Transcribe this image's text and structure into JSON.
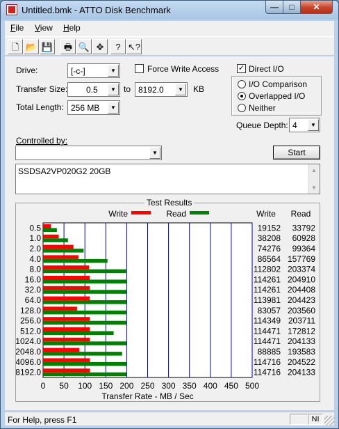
{
  "window": {
    "title": "Untitled.bmk - ATTO Disk Benchmark"
  },
  "window_buttons": {
    "minimize": "—",
    "maximize": "□",
    "close": "✕"
  },
  "menu": [
    {
      "accel": "F",
      "rest": "ile"
    },
    {
      "accel": "V",
      "rest": "iew"
    },
    {
      "accel": "H",
      "rest": "elp"
    }
  ],
  "toolbar_icons": [
    "new-icon",
    "open-icon",
    "save-icon",
    "print-icon",
    "print-preview-icon",
    "move-icon",
    "help-icon",
    "context-help-icon"
  ],
  "drive": {
    "label": "Drive:",
    "value": "[-c-]"
  },
  "transfer_size": {
    "label": "Transfer Size:",
    "from": "0.5",
    "to_label": "to",
    "to": "8192.0",
    "unit": "KB"
  },
  "total_length": {
    "label": "Total Length:",
    "value": "256 MB"
  },
  "force_write_access": {
    "label": "Force Write Access",
    "checked": false
  },
  "direct_io": {
    "label": "Direct I/O",
    "checked": true,
    "mark": "✓"
  },
  "io_mode": {
    "options": [
      {
        "label": "I/O Comparison",
        "selected": false
      },
      {
        "label": "Overlapped I/O",
        "selected": true
      },
      {
        "label": "Neither",
        "selected": false
      }
    ]
  },
  "queue_depth": {
    "label": "Queue Depth:",
    "value": "4"
  },
  "controlled_by": {
    "label": "Controlled by:",
    "value": ""
  },
  "start_button": {
    "label": "Start"
  },
  "description": {
    "text": "SSDSA2VP020G2 20GB"
  },
  "colors": {
    "write": "#ff0000",
    "read": "#008000",
    "grid": "#0000c0"
  },
  "chart_data": {
    "type": "bar",
    "title": "Test Results",
    "orientation": "horizontal",
    "xlabel": "Transfer Rate - MB / Sec",
    "xlim": [
      0,
      500
    ],
    "xticks": [
      0,
      50,
      100,
      150,
      200,
      250,
      300,
      350,
      400,
      450,
      500
    ],
    "legend": [
      "Write",
      "Read"
    ],
    "column_headers": [
      "Write",
      "Read"
    ],
    "categories": [
      "0.5",
      "1.0",
      "2.0",
      "4.0",
      "8.0",
      "16.0",
      "32.0",
      "64.0",
      "128.0",
      "256.0",
      "512.0",
      "1024.0",
      "2048.0",
      "4096.0",
      "8192.0"
    ],
    "series": [
      {
        "name": "Write",
        "values": [
          19152,
          38208,
          74276,
          86564,
          112802,
          114261,
          114261,
          113981,
          83057,
          114349,
          114471,
          114471,
          88885,
          114716,
          114716
        ]
      },
      {
        "name": "Read",
        "values": [
          33792,
          60928,
          99364,
          157769,
          203374,
          204910,
          204408,
          204423,
          203560,
          203711,
          172812,
          204133,
          193583,
          204522,
          204133
        ]
      }
    ]
  },
  "status": {
    "text": "For Help, press F1",
    "indicator": "NI"
  }
}
